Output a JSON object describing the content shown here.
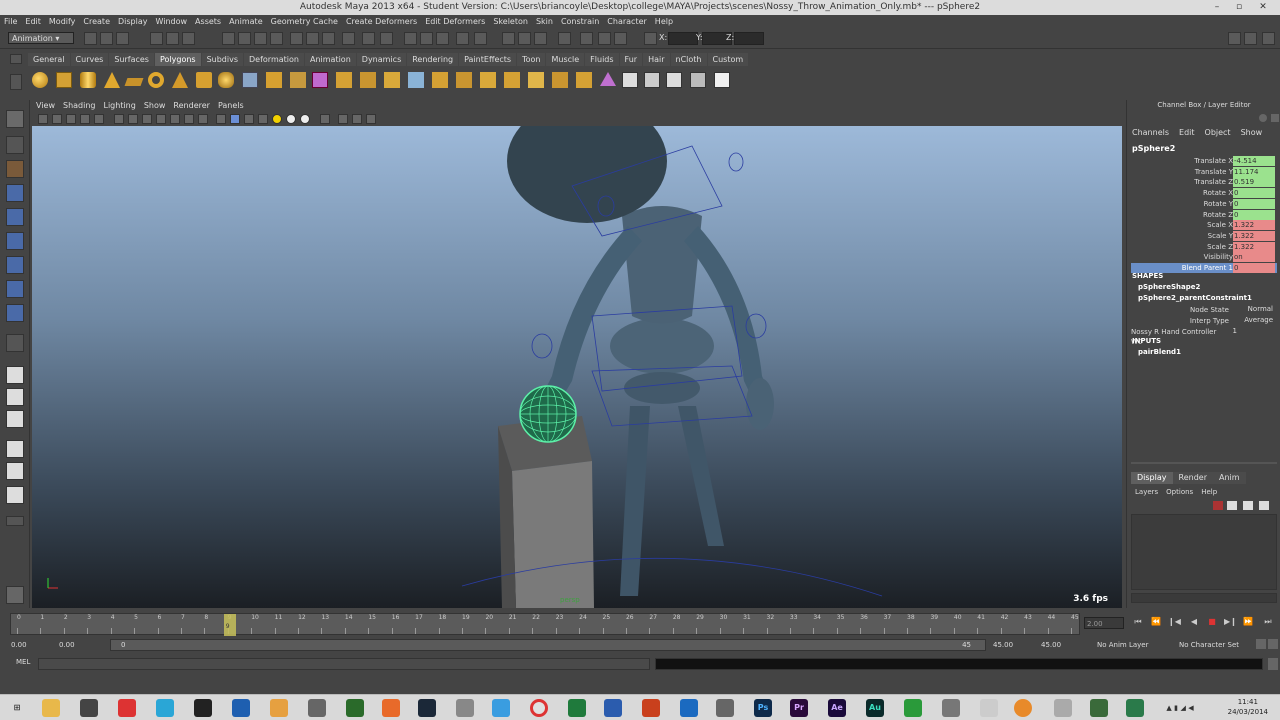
{
  "window": {
    "title": "Autodesk Maya 2013 x64 - Student Version: C:\\Users\\briancoyle\\Desktop\\college\\MAYA\\Projects\\scenes\\Nossy_Throw_Animation_Only.mb*  ---  pSphere2",
    "minimize": "–",
    "maximize": "▫",
    "close": "✕"
  },
  "menubar": [
    "File",
    "Edit",
    "Modify",
    "Create",
    "Display",
    "Window",
    "Assets",
    "Animate",
    "Geometry Cache",
    "Create Deformers",
    "Edit Deformers",
    "Skeleton",
    "Skin",
    "Constrain",
    "Character",
    "Help"
  ],
  "statusline": {
    "mode": "Animation",
    "xyz_labels": [
      "X:",
      "Y:",
      "Z:"
    ]
  },
  "shelf": {
    "tabs": [
      "General",
      "Curves",
      "Surfaces",
      "Polygons",
      "Subdivs",
      "Deformation",
      "Animation",
      "Dynamics",
      "Rendering",
      "PaintEffects",
      "Toon",
      "Muscle",
      "Fluids",
      "Fur",
      "Hair",
      "nCloth",
      "Custom"
    ],
    "active_tab": "Polygons"
  },
  "panel": {
    "menu": [
      "View",
      "Shading",
      "Lighting",
      "Show",
      "Renderer",
      "Panels"
    ],
    "fps": "3.6 fps",
    "camera": "persp"
  },
  "channel_box": {
    "header": "Channel Box / Layer Editor",
    "menu": [
      "Channels",
      "Edit",
      "Object",
      "Show"
    ],
    "object": "pSphere2",
    "attributes": [
      {
        "label": "Translate X",
        "value": "-4.514",
        "color": "#9be28e"
      },
      {
        "label": "Translate Y",
        "value": "11.174",
        "color": "#9be28e"
      },
      {
        "label": "Translate Z",
        "value": "0.519",
        "color": "#9be28e"
      },
      {
        "label": "Rotate X",
        "value": "0",
        "color": "#9be28e"
      },
      {
        "label": "Rotate Y",
        "value": "0",
        "color": "#9be28e"
      },
      {
        "label": "Rotate Z",
        "value": "0",
        "color": "#9be28e"
      },
      {
        "label": "Scale X",
        "value": "1.322",
        "color": "#e88a8a"
      },
      {
        "label": "Scale Y",
        "value": "1.322",
        "color": "#e88a8a"
      },
      {
        "label": "Scale Z",
        "value": "1.322",
        "color": "#e88a8a"
      },
      {
        "label": "Visibility",
        "value": "on",
        "color": "#e88a8a"
      },
      {
        "label": "Blend Parent 1",
        "value": "0",
        "color": "#e88a8a"
      }
    ],
    "shapes_label": "SHAPES",
    "shape_node": "pSphereShape2",
    "constraint_node": "pSphere2_parentConstraint1",
    "constraint_attrs": [
      {
        "label": "Node State",
        "value": "Normal"
      },
      {
        "label": "Interp Type",
        "value": "Average"
      },
      {
        "label": "Nossy R Hand Controller W0",
        "value": "1"
      }
    ],
    "inputs_label": "INPUTS",
    "input_node": "pairBlend1"
  },
  "layer_editor": {
    "tabs": [
      "Display",
      "Render",
      "Anim"
    ],
    "active_tab": "Display",
    "menu": [
      "Layers",
      "Options",
      "Help"
    ]
  },
  "time_slider": {
    "ticks": [
      "0",
      "1",
      "2",
      "3",
      "4",
      "5",
      "6",
      "7",
      "8",
      "9",
      "10",
      "11",
      "12",
      "13",
      "14",
      "15",
      "16",
      "17",
      "18",
      "19",
      "20",
      "21",
      "22",
      "23",
      "24",
      "25",
      "26",
      "27",
      "28",
      "29",
      "30",
      "31",
      "32",
      "33",
      "34",
      "35",
      "36",
      "37",
      "38",
      "39",
      "40",
      "41",
      "42",
      "43",
      "44",
      "45"
    ],
    "current_frame": "9",
    "current_value": "2.00"
  },
  "range_slider": {
    "start": "0.00",
    "playback_start": "0.00",
    "range_start_marker": "0",
    "range_end_marker": "45",
    "playback_end": "45.00",
    "end": "45.00",
    "anim_layer": "No Anim Layer",
    "character_set": "No Character Set"
  },
  "command_line": {
    "label": "MEL"
  },
  "taskbar": {
    "time": "11:41",
    "date": "24/03/2014"
  }
}
